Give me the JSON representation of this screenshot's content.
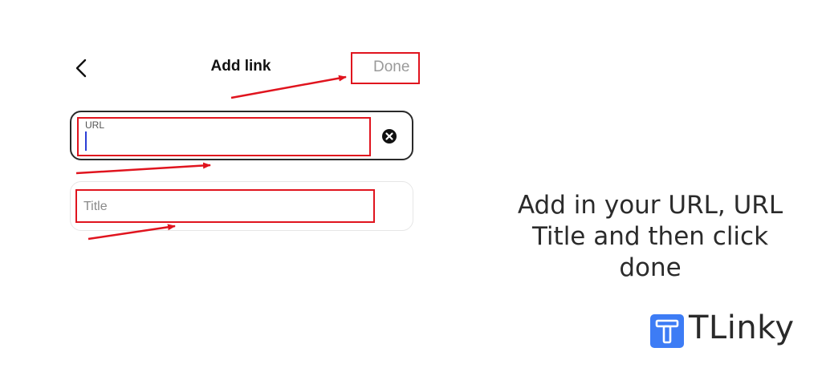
{
  "header": {
    "title": "Add link",
    "done_label": "Done"
  },
  "form": {
    "url_label": "URL",
    "url_value": "",
    "title_placeholder": "Title",
    "title_value": ""
  },
  "instruction": "Add in your URL, URL Title and then click done",
  "brand": {
    "name": "TLinky",
    "logo_letter": "T",
    "logo_color": "#3d7cf5"
  },
  "colors": {
    "highlight": "#e0141e",
    "caret": "#2c3fd6"
  },
  "icons": {
    "back": "chevron-left-icon",
    "clear": "close-circle-icon"
  }
}
